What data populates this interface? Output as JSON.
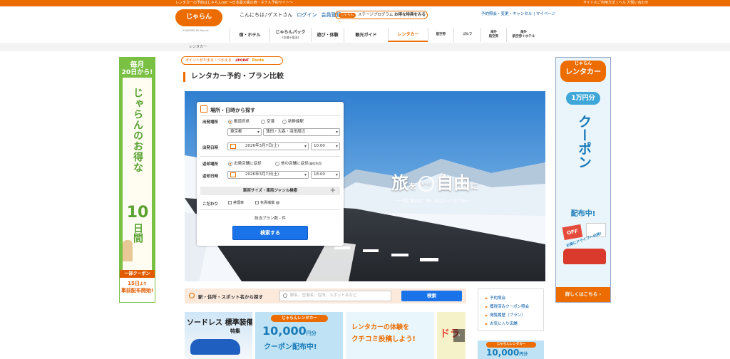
{
  "topbar": {
    "left_text": "レンタカーの予約はじゃらんnet 〜日本最大級の宿・ホテル予約サイト〜",
    "right_text": "サイトのご利用方法 | ヘルプ/問い合わせ"
  },
  "header": {
    "logo_text": "じゃらん",
    "logo_sub": "POWERED BY Recruit",
    "greeting": "こんにちは♪ゲストさん",
    "login": "ログイン",
    "register": "会員登録",
    "stage_badge": "じゃらん",
    "stage_text": "ステージプログラム",
    "stage_sub": "お得な特典をみる",
    "account_links": "予約照会・変更・キャンセル | マイページ"
  },
  "nav": [
    {
      "label": "宿・ホテル"
    },
    {
      "label": "じゃらんパック",
      "sub": "(交通＋宿泊)"
    },
    {
      "label": "遊び・体験"
    },
    {
      "label": "観光ガイド"
    },
    {
      "label": "レンタカー"
    },
    {
      "label": "航空券"
    },
    {
      "label": "ゴルフ"
    },
    {
      "label": "海外",
      "sub": "航空券"
    },
    {
      "label": "海外",
      "sub": "航空券＋ホテル"
    }
  ],
  "breadcrumb": "レンタカー",
  "point_banner": {
    "text": "ポイントがたまる・つかえる",
    "dpoint": "dPOINT",
    "ponta": "Ponta"
  },
  "page_title": "レンタカー予約・プラン比較",
  "hero": {
    "catch_a": "旅",
    "catch_b": "を",
    "catch_c": "もっと",
    "catch_d": "自由",
    "catch_e": "に",
    "catch_sub": "〜一度に乗れば、楽しみはもっと広がる〜"
  },
  "search": {
    "header": "場所・日時から探す",
    "depart_place_label": "出発場所",
    "radios": [
      "都道府県",
      "空港",
      "新幹線駅"
    ],
    "prefecture": "東京都",
    "area": "蒲田・大森・羽田周辺",
    "depart_date_label": "出発日時",
    "depart_date": "2026年3月7日(土)",
    "depart_time": "10:00",
    "return_place_label": "返却場所",
    "return_radio_1": "出発店舗に返却",
    "return_radio_2": "他の店舗に返却",
    "return_radio_2_note": "(乗捨利用)",
    "return_date_label": "返却日時",
    "return_date": "2026年3月7日(土)",
    "return_time": "18:00",
    "vehicle_toggle": "車両サイズ・車両ジャンル検索",
    "kodawari_label": "こだわり",
    "nonsmoking": "禁煙車",
    "insurance": "免責補償",
    "plans_count": "該当プラン数 - 件",
    "submit": "検索する"
  },
  "station_search": {
    "label": "駅・住所・スポット名から探す",
    "placeholder": "駅名、空港名、住所、スポット名など",
    "button": "検索"
  },
  "links": [
    "予約照会",
    "獲得済みクーポン照会",
    "閲覧履歴（プラン）",
    "お気に入り店舗"
  ],
  "left_banner": {
    "top_1": "毎月",
    "top_2": "20日から!",
    "vertical_1": "じゃらんのお得な",
    "big": "10",
    "unit": "日間",
    "coupon": "一部クーポン",
    "bottom_1": "15日",
    "bottom_1b": "より",
    "bottom_2": "事前配布開始!"
  },
  "right_banner": {
    "logo": "じゃらん",
    "title": "レンタカー",
    "amount": "1万円分",
    "vertical": "クーポン",
    "dist": "配布中!",
    "off": "OFF",
    "drive": "お得にドライブへ出発!",
    "more": "詳しくはこちら"
  },
  "cards": [
    {
      "text": "ソードレス 標準装備",
      "sub": "特集"
    },
    {
      "brand": "じゃらんレンタカー",
      "amount": "10,000",
      "unit": "円分",
      "coupon": "クーポン配布中!"
    },
    {
      "line1": "レンタカーの体験を",
      "line2": "クチコミ投稿しよう!"
    },
    {
      "text": "ドラ"
    }
  ],
  "right_card": {
    "brand": "じゃらんレンタカー",
    "amount": "10,000",
    "unit": "円分"
  },
  "colors": {
    "brand": "#ec6c00",
    "button": "#1a73e8",
    "green": "#79c043"
  }
}
